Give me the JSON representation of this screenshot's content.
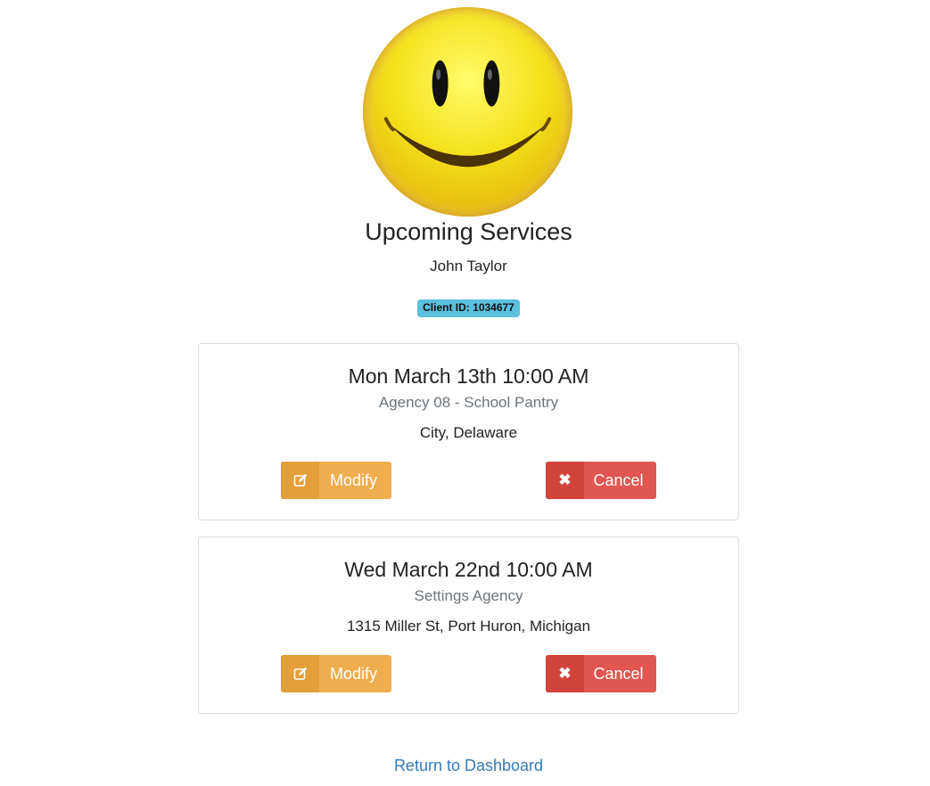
{
  "page": {
    "title": "Upcoming Services",
    "client_name": "John Taylor",
    "client_id_badge": "Client ID: 1034677",
    "return_link": "Return to Dashboard"
  },
  "avatar": {
    "icon": "smiley-face-icon"
  },
  "services": [
    {
      "date": "Mon March 13th 10:00 AM",
      "agency": "Agency 08 - School Pantry",
      "location": "City, Delaware",
      "modify_label": "Modify",
      "cancel_label": "Cancel"
    },
    {
      "date": "Wed March 22nd 10:00 AM",
      "agency": "Settings Agency",
      "location": "1315 Miller St, Port Huron, Michigan",
      "modify_label": "Modify",
      "cancel_label": "Cancel"
    }
  ],
  "colors": {
    "modify": "#f0ad4e",
    "cancel": "#e0574f",
    "badge": "#5bc0de",
    "link": "#337ab7"
  }
}
